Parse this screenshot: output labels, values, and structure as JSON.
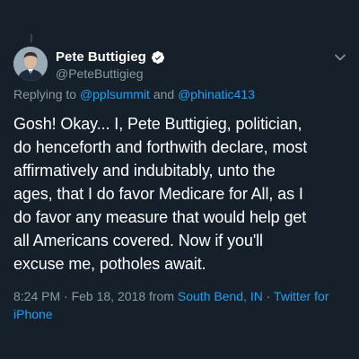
{
  "author": {
    "display_name": "Pete Buttigieg",
    "handle": "@PeteButtigieg",
    "verified": true,
    "avatar_icon": "profile-photo"
  },
  "reply": {
    "prefix": "Replying to",
    "mention_1": "@pplsummit",
    "conjunction": "and",
    "mention_2": "@phinatic413"
  },
  "tweet": {
    "text_lines": [
      "Gosh! Okay... I, Pete Buttigieg, politician,",
      "do henceforth and forthwith declare, most",
      "affirmatively and indubitably, unto the",
      "ages, that I do favor Medicare for All, as I",
      "do favor any measure that would help get",
      "all Americans covered. Now if you'll",
      "excuse me, potholes await."
    ]
  },
  "meta": {
    "time": "8:24 PM",
    "separator": "·",
    "date": "Feb 18, 2018",
    "from_label": "from",
    "location": "South Bend, IN",
    "source_part1": "Twitter for",
    "source_part2": "iPhone"
  },
  "colors": {
    "background": "#15202b",
    "text": "#ffffff",
    "secondary": "#8899a6",
    "accent": "#1da1f2"
  }
}
